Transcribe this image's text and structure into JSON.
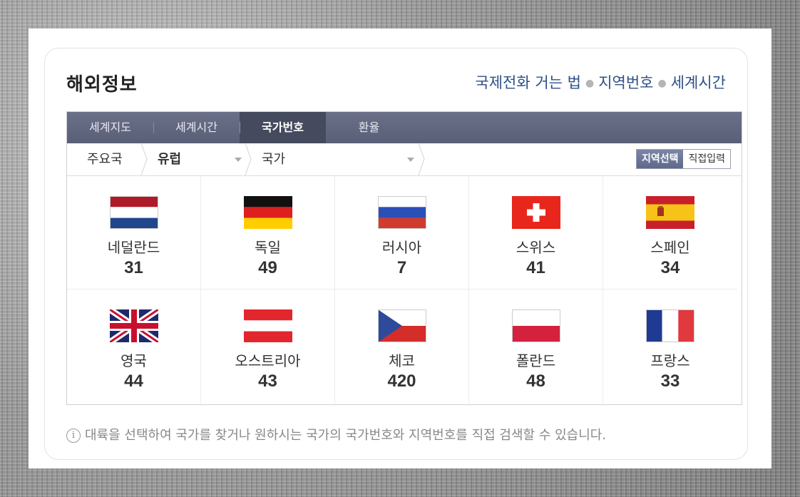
{
  "header": {
    "title": "해외정보",
    "links": [
      "국제전화 거는 법",
      "지역번호",
      "세계시간"
    ]
  },
  "tabs": [
    "세계지도",
    "세계시간",
    "국가번호",
    "환율"
  ],
  "active_tab": "국가번호",
  "filter": {
    "region_root": "주요국",
    "region_selected": "유럽",
    "country_placeholder": "국가",
    "toggle_on": "지역선택",
    "toggle_off": "직접입력"
  },
  "countries": [
    {
      "name": "네덜란드",
      "code": "31",
      "flag": "netherlands-flag-icon"
    },
    {
      "name": "독일",
      "code": "49",
      "flag": "germany-flag-icon"
    },
    {
      "name": "러시아",
      "code": "7",
      "flag": "russia-flag-icon"
    },
    {
      "name": "스위스",
      "code": "41",
      "flag": "switzerland-flag-icon"
    },
    {
      "name": "스페인",
      "code": "34",
      "flag": "spain-flag-icon"
    },
    {
      "name": "영국",
      "code": "44",
      "flag": "uk-flag-icon"
    },
    {
      "name": "오스트리아",
      "code": "43",
      "flag": "austria-flag-icon"
    },
    {
      "name": "체코",
      "code": "420",
      "flag": "czech-flag-icon"
    },
    {
      "name": "폴란드",
      "code": "48",
      "flag": "poland-flag-icon"
    },
    {
      "name": "프랑스",
      "code": "33",
      "flag": "france-flag-icon"
    }
  ],
  "note": "대륙을 선택하여 국가를 찾거나 원하시는 국가의 국가번호와 지역번호를 직접 검색할 수 있습니다.",
  "info_glyph": "i",
  "colors": {
    "link": "#2d4f88",
    "tabbar": "#5a5f78",
    "tab_active": "#454a5e",
    "toggle_on": "#5f6a8b"
  }
}
